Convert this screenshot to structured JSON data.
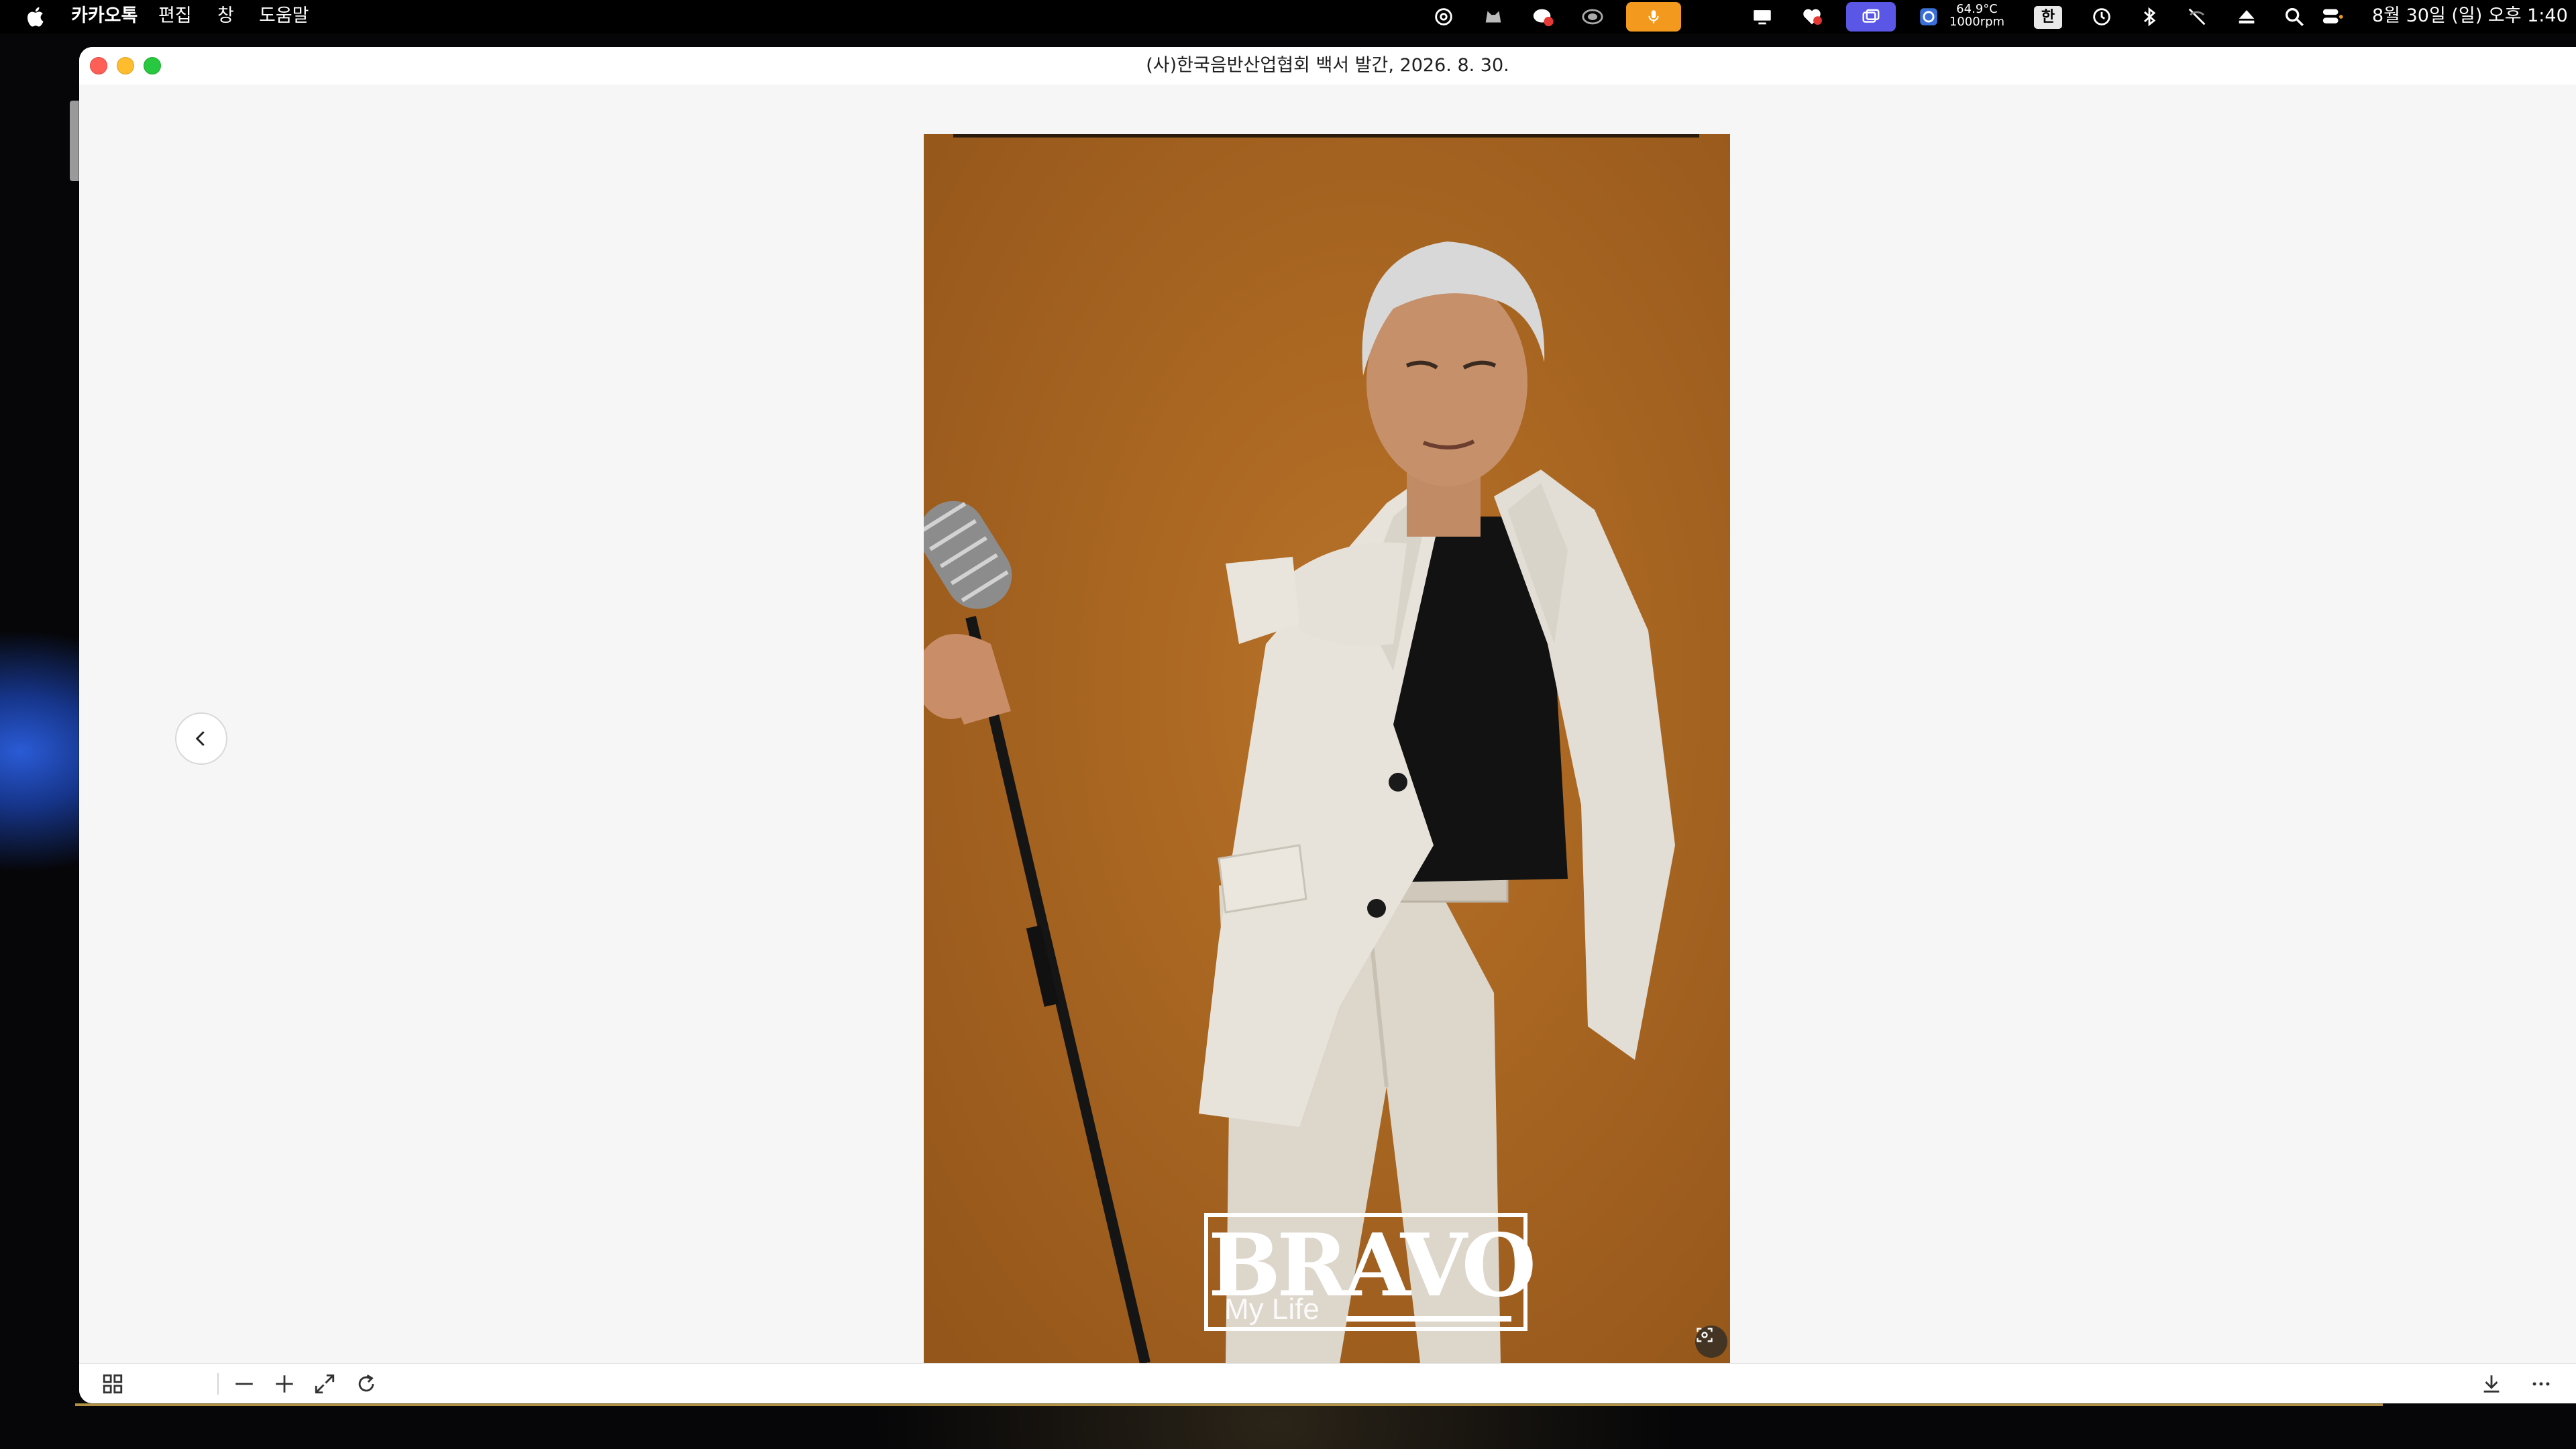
{
  "menubar": {
    "app_name": "카카오톡",
    "menus": [
      "편집",
      "창",
      "도움말"
    ],
    "temperature": "64.9°C",
    "fan_speed": "1000rpm",
    "input_method": "한",
    "clock": "8월 30일 (일) 오후 1:40",
    "status_icons": [
      "chatgpt-icon",
      "cat-icon",
      "kakaotalk-icon",
      "vpn-icon",
      "microphone-icon",
      "display-icon",
      "heart-icon",
      "screen-share-icon",
      "fan-monitor-icon",
      "time-machine-icon",
      "bluetooth-icon",
      "wifi-off-icon",
      "eject-icon",
      "search-icon",
      "control-center-icon"
    ]
  },
  "window": {
    "title": "(사)한국음반산업협회 백서 발간, 2026. 8. 30."
  },
  "photo": {
    "logo_text": "BRAVO",
    "logo_subtext": "My Life",
    "background_color": "#a8641f"
  },
  "toolbar": {
    "left_tools": [
      "grid-view-icon",
      "zoom-out-icon",
      "zoom-in-icon",
      "fit-screen-icon",
      "rotate-icon"
    ],
    "right_tools": [
      "download-icon",
      "more-icon"
    ]
  }
}
